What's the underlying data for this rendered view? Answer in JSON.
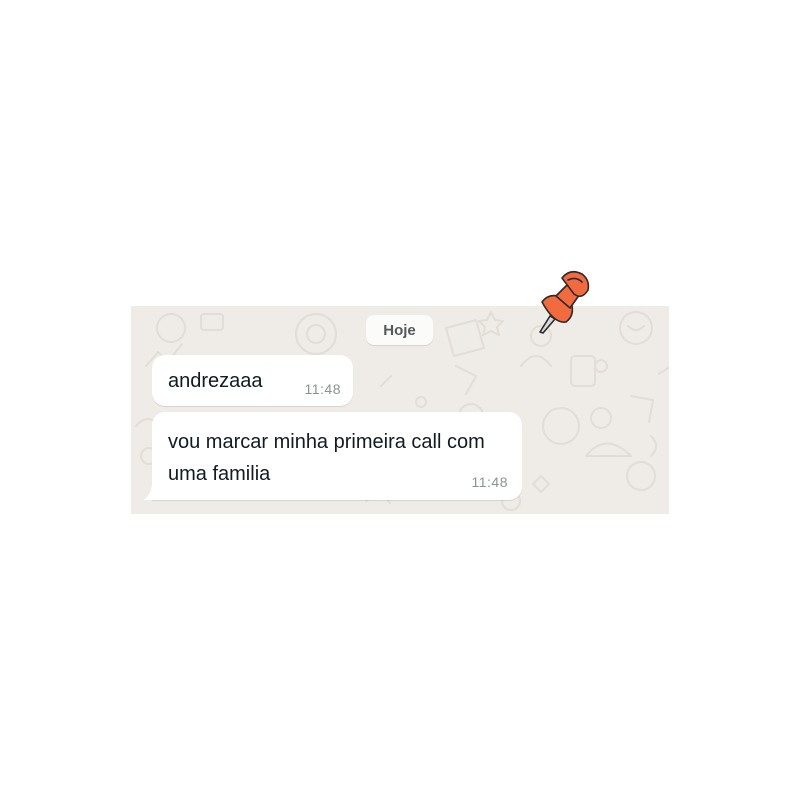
{
  "date_divider": {
    "label": "Hoje"
  },
  "messages": [
    {
      "text": "andrezaaa",
      "time": "11:48"
    },
    {
      "text": "vou marcar minha primeira call com uma familia",
      "time": "11:48"
    }
  ],
  "decoration": {
    "pin_icon": "pushpin-icon",
    "pin_color": "#f26a3d"
  },
  "colors": {
    "chat_background": "#efebe6",
    "bubble": "#ffffff",
    "text": "#111b21",
    "timestamp": "#8b9296"
  }
}
